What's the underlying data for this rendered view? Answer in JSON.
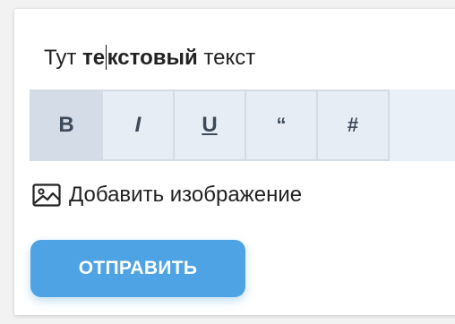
{
  "editor": {
    "text_before": "Тут ",
    "bold_part1": "те",
    "bold_part2": "кстовый",
    "text_after": " текст"
  },
  "toolbar": {
    "buttons": [
      {
        "label": "B",
        "name": "bold"
      },
      {
        "label": "I",
        "name": "italic"
      },
      {
        "label": "U",
        "name": "underline"
      },
      {
        "label": "“",
        "name": "quote"
      },
      {
        "label": "#",
        "name": "hashtag"
      }
    ]
  },
  "add_image": {
    "label": "Добавить изображение",
    "icon": "image-icon"
  },
  "submit": {
    "label": "ОТПРАВИТЬ"
  },
  "colors": {
    "accent": "#4da3e4",
    "toolbar_bg": "#eaf0f7",
    "toolbar_border": "#d3dbe5",
    "active_button": "#d3dce7"
  }
}
